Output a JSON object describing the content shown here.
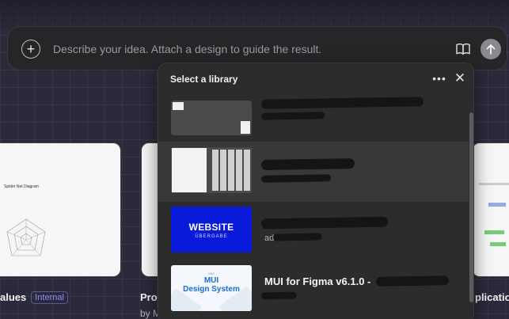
{
  "prompt": {
    "placeholder": "Describe your idea. Attach a design to guide the result."
  },
  "cards": [
    {
      "label": "alues",
      "badge": "Internal",
      "thumb_caption": "Spider Net Diagram"
    },
    {
      "label": "Pro",
      "sub": "by M"
    },
    {
      "label": "plicatio"
    }
  ],
  "library_panel": {
    "title": "Select a library",
    "items": [
      {
        "name": "",
        "meta": ""
      },
      {
        "name": "",
        "meta": ""
      },
      {
        "name": "",
        "meta": "ad",
        "thumb_title": "WEBSITE",
        "thumb_sub": "ÜBERGABE"
      },
      {
        "name": "MUI for Figma v6.1.0 -",
        "meta": "",
        "thumb_title": "MUI\nDesign System",
        "thumb_sub": "MUI"
      }
    ]
  },
  "colors": {
    "website_thumb": "#0a1adb",
    "mui_blue": "#1a6fd1",
    "badge": "#8c8cf2"
  },
  "icons": [
    "plus-icon",
    "book-icon",
    "arrow-up-icon",
    "more-icon",
    "close-icon"
  ]
}
